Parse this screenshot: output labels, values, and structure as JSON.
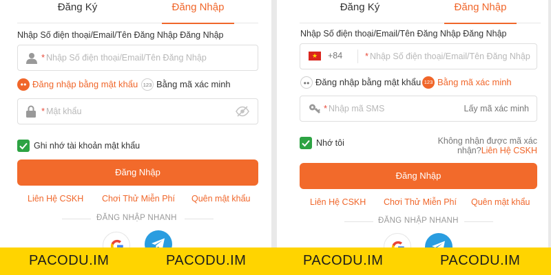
{
  "left": {
    "tabs": {
      "register": "Đăng Ký",
      "login": "Đăng Nhập"
    },
    "field_label": "Nhập Số điện thoại/Email/Tên Đăng Nhập Đăng Nhập",
    "account_placeholder": "Nhập Số điện thoại/Email/Tên Đăng Nhập",
    "options": {
      "password": "Đăng nhập bằng mật khẩu",
      "code": "Bằng mã xác minh",
      "code_badge": "123"
    },
    "password_placeholder": "Mật khẩu",
    "remember": "Ghi nhớ tài khoản mật khẩu",
    "login_button": "Đăng Nhập",
    "links": {
      "support": "Liên Hệ CSKH",
      "free_play": "Chơi Thử Miễn Phí",
      "forgot": "Quên mật khẩu"
    },
    "quick_login": "ĐĂNG NHẬP NHANH",
    "social": {
      "google": "google-icon",
      "telegram": "telegram-icon"
    }
  },
  "right": {
    "tabs": {
      "register": "Đăng Ký",
      "login": "Đăng Nhập"
    },
    "field_label": "Nhập Số điện thoại/Email/Tên Đăng Nhập Đăng Nhập",
    "country_code": "+84",
    "phone_placeholder": "Nhập Số điện thoại/Email/Tên Đăng Nhập",
    "options": {
      "password": "Đăng nhập bằng mật khẩu",
      "code": "Bằng mã xác minh",
      "code_badge": "123"
    },
    "sms_placeholder": "Nhập mã SMS",
    "get_code": "Lấy mã xác minh",
    "remember": "Nhớ tôi",
    "no_code_line1": "Không nhận được mã xác",
    "no_code_line2": "nhận?",
    "no_code_link": "Liên Hệ CSKH",
    "login_button": "Đăng Nhập",
    "links": {
      "support": "Liên Hệ CSKH",
      "free_play": "Chơi Thử Miễn Phí",
      "forgot": "Quên mật khẩu"
    },
    "quick_login": "ĐĂNG NHẬP NHANH",
    "social": {
      "google": "google-icon",
      "telegram": "telegram-icon"
    }
  },
  "banner": {
    "brand": "PACODU.IM"
  },
  "colors": {
    "accent": "#f26a2b",
    "check": "#2da343",
    "banner": "#ffd400",
    "telegram": "#2a9de0"
  }
}
